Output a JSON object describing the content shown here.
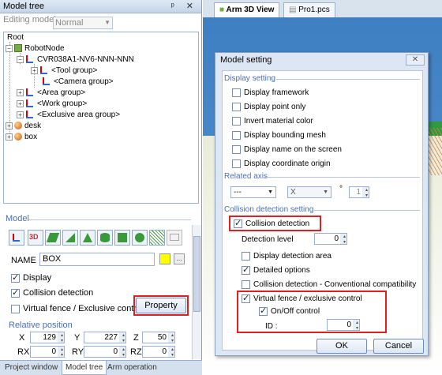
{
  "left_panel": {
    "title": "Model tree",
    "title_controls": "ᵖ ✕",
    "editing_model_label": "Editing model",
    "editing_model_value": "Normal",
    "tree": {
      "root": "Root",
      "robot_node": "RobotNode",
      "robot_model": "CVR038A1-NV6-NNN-NNN",
      "tool_group": "<Tool group>",
      "camera_group": "<Camera group>",
      "area_group": "<Area group>",
      "work_group": "<Work group>",
      "exclusive_area_group": "<Exclusive area group>",
      "desk": "desk",
      "box": "box"
    },
    "model_section_label": "Model",
    "name_label": "NAME",
    "name_value": "BOX",
    "name_color": "#ffff00",
    "dots_label": "…",
    "display_label": "Display",
    "display_checked": true,
    "collision_label": "Collision detection",
    "collision_checked": true,
    "virtual_fence_label": "Virtual fence / Exclusive control",
    "virtual_fence_checked": false,
    "property_button": "Property",
    "relative_position_label": "Relative position",
    "coords": {
      "x_label": "X",
      "x_value": "129",
      "y_label": "Y",
      "y_value": "227",
      "z_label": "Z",
      "z_value": "50",
      "rx_label": "RX",
      "rx_value": "0",
      "ry_label": "RY",
      "ry_value": "0",
      "rz_label": "RZ",
      "rz_value": "0"
    },
    "bottom_tabs": [
      "Project window",
      "Model tree",
      "Arm operation"
    ]
  },
  "right_panel": {
    "tabs": [
      "Arm 3D View",
      "Pro1.pcs"
    ]
  },
  "dialog": {
    "title": "Model setting",
    "close_icon": "✕",
    "display_setting_label": "Display setting",
    "display_options": [
      {
        "label": "Display framework",
        "checked": false
      },
      {
        "label": "Display point only",
        "checked": false
      },
      {
        "label": "Invert material color",
        "checked": false
      },
      {
        "label": "Display bounding mesh",
        "checked": false
      },
      {
        "label": "Display name on the screen",
        "checked": false
      },
      {
        "label": "Display coordinate origin",
        "checked": false
      }
    ],
    "related_axis_label": "Related axis",
    "axis_combo1": "---",
    "axis_combo2": "X",
    "axis_degree": "°",
    "axis_value": "1",
    "collision_setting_label": "Collision detection setting",
    "collision_detection_label": "Collision detection",
    "collision_detection_checked": true,
    "detection_level_label": "Detection level",
    "detection_level_value": "0",
    "display_detection_area_label": "Display detection area",
    "display_detection_area_checked": false,
    "detailed_options_label": "Detailed options",
    "detailed_options_checked": true,
    "conventional_label": "Collision detection - Conventional compatibility",
    "conventional_checked": false,
    "virtual_fence_label": "Virtual fence / exclusive control",
    "virtual_fence_checked": true,
    "onoff_label": "On/Off control",
    "onoff_checked": true,
    "id_label": "ID :",
    "id_value": "0",
    "ok_button": "OK",
    "cancel_button": "Cancel"
  }
}
